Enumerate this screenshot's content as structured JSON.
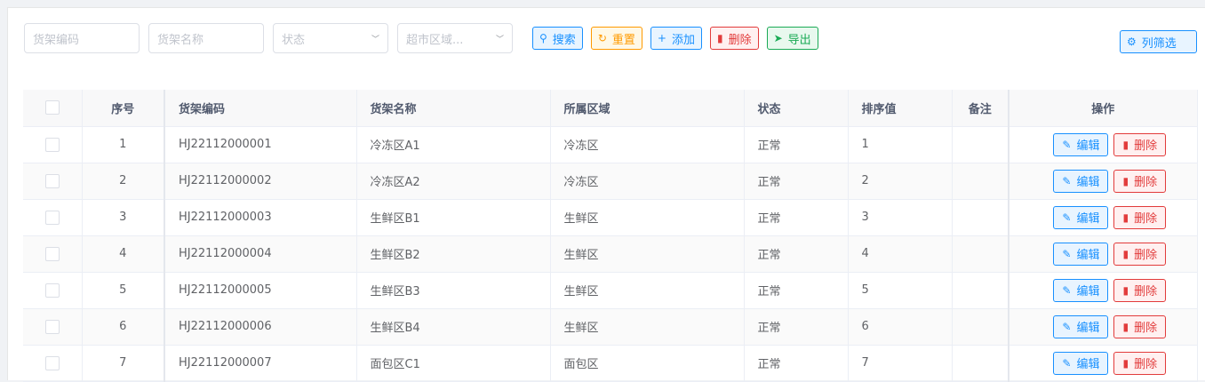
{
  "filters": {
    "code_placeholder": "货架编码",
    "name_placeholder": "货架名称",
    "status_placeholder": "状态",
    "area_placeholder": "超市区域..."
  },
  "buttons": {
    "search": "搜索",
    "reset": "重置",
    "add": "添加",
    "delete": "删除",
    "export": "导出",
    "column_filter": "列筛选"
  },
  "table": {
    "headers": [
      "序号",
      "货架编码",
      "货架名称",
      "所属区域",
      "状态",
      "排序值",
      "备注",
      "操作"
    ],
    "edit_label": "编辑",
    "delete_label": "删除",
    "rows": [
      {
        "no": "1",
        "code": "HJ22112000001",
        "name": "冷冻区A1",
        "area": "冷冻区",
        "status": "正常",
        "sort": "1",
        "remark": ""
      },
      {
        "no": "2",
        "code": "HJ22112000002",
        "name": "冷冻区A2",
        "area": "冷冻区",
        "status": "正常",
        "sort": "2",
        "remark": ""
      },
      {
        "no": "3",
        "code": "HJ22112000003",
        "name": "生鲜区B1",
        "area": "生鲜区",
        "status": "正常",
        "sort": "3",
        "remark": ""
      },
      {
        "no": "4",
        "code": "HJ22112000004",
        "name": "生鲜区B2",
        "area": "生鲜区",
        "status": "正常",
        "sort": "4",
        "remark": ""
      },
      {
        "no": "5",
        "code": "HJ22112000005",
        "name": "生鲜区B3",
        "area": "生鲜区",
        "status": "正常",
        "sort": "5",
        "remark": ""
      },
      {
        "no": "6",
        "code": "HJ22112000006",
        "name": "生鲜区B4",
        "area": "生鲜区",
        "status": "正常",
        "sort": "6",
        "remark": ""
      },
      {
        "no": "7",
        "code": "HJ22112000007",
        "name": "面包区C1",
        "area": "面包区",
        "status": "正常",
        "sort": "7",
        "remark": ""
      }
    ]
  },
  "colors": {
    "primary": "#1890ff",
    "warning": "#ff9a00",
    "danger": "#e23b3b",
    "success": "#1aaa55"
  }
}
